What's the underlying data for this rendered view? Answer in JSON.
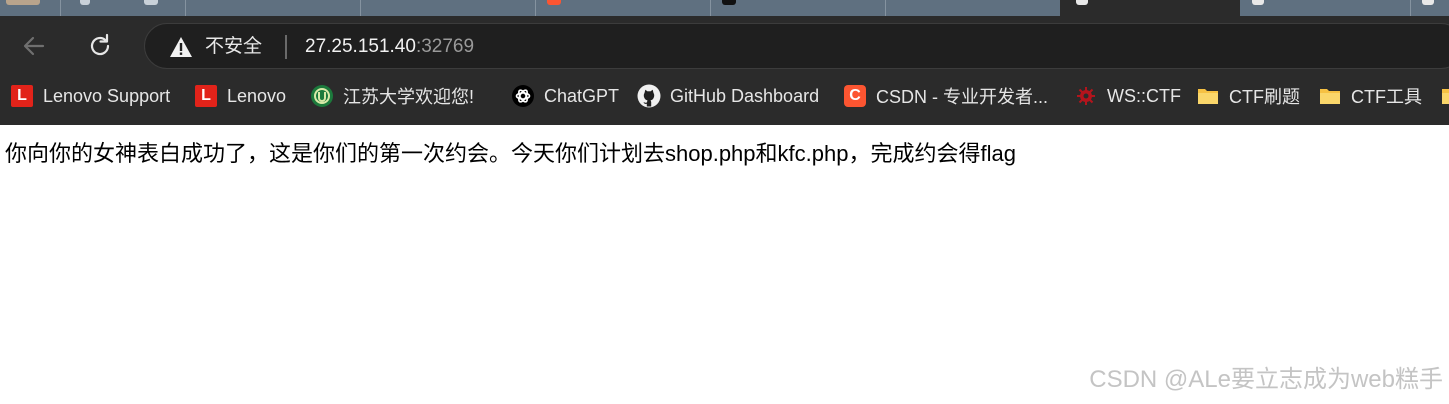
{
  "address_bar": {
    "security_label": "不安全",
    "host": "27.25.151.40",
    "port": ":32769"
  },
  "bookmarks": [
    {
      "label": "Lenovo Support",
      "icon": "lenovo-icon"
    },
    {
      "label": "Lenovo",
      "icon": "lenovo-icon"
    },
    {
      "label": "江苏大学欢迎您!",
      "icon": "university-icon"
    },
    {
      "label": "ChatGPT",
      "icon": "chatgpt-icon"
    },
    {
      "label": "GitHub Dashboard",
      "icon": "github-icon"
    },
    {
      "label": "CSDN - 专业开发者...",
      "icon": "csdn-icon"
    },
    {
      "label": "WS::CTF",
      "icon": "ws-ctf-icon"
    },
    {
      "label": "CTF刷题",
      "icon": "folder-icon"
    },
    {
      "label": "CTF工具",
      "icon": "folder-icon"
    }
  ],
  "page": {
    "message": "你向你的女神表白成功了，这是你们的第一次约会。今天你们计划去shop.php和kfc.php，完成约会得flag"
  },
  "watermark": "CSDN @ALe要立志成为web糕手",
  "colors": {
    "toolbar_bg": "#2b2b2b",
    "tabstrip_bg": "#5f7080",
    "lenovo_red": "#e2231a",
    "csdn_orange": "#fc5531",
    "folder_yellow": "#f6c143"
  }
}
